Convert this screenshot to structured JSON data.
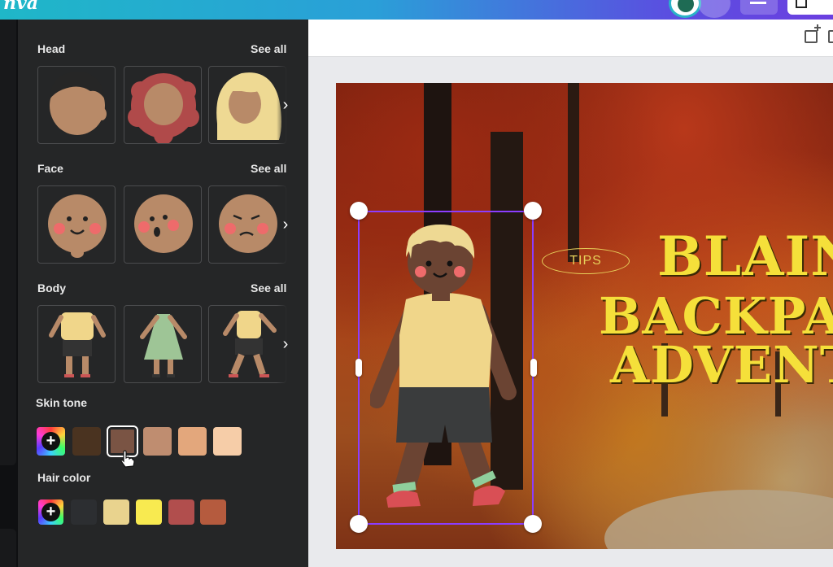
{
  "topbar": {
    "logo_text": "nva"
  },
  "panel": {
    "sections": [
      {
        "title": "Head",
        "see_all": "See all"
      },
      {
        "title": "Face",
        "see_all": "See all"
      },
      {
        "title": "Body",
        "see_all": "See all"
      }
    ],
    "skin_tone": {
      "label": "Skin tone",
      "add_icon": "+",
      "colors": [
        "#4a3320",
        "#7a5444",
        "#bf8d70",
        "#e3a77c",
        "#f6cda8"
      ],
      "selected_index": 1
    },
    "hair_color": {
      "label": "Hair color",
      "add_icon": "+",
      "colors": [
        "#2c2e31",
        "#e9d38e",
        "#f8ea50",
        "#b14e4d",
        "#b55b3e"
      ]
    }
  },
  "canvas": {
    "tips_label": "TIPS",
    "headline_lines": [
      "BLAIN",
      "BACKPAC",
      "ADVENT"
    ],
    "headline_color": "#f5e03a",
    "selection_color": "#8b3dff"
  }
}
